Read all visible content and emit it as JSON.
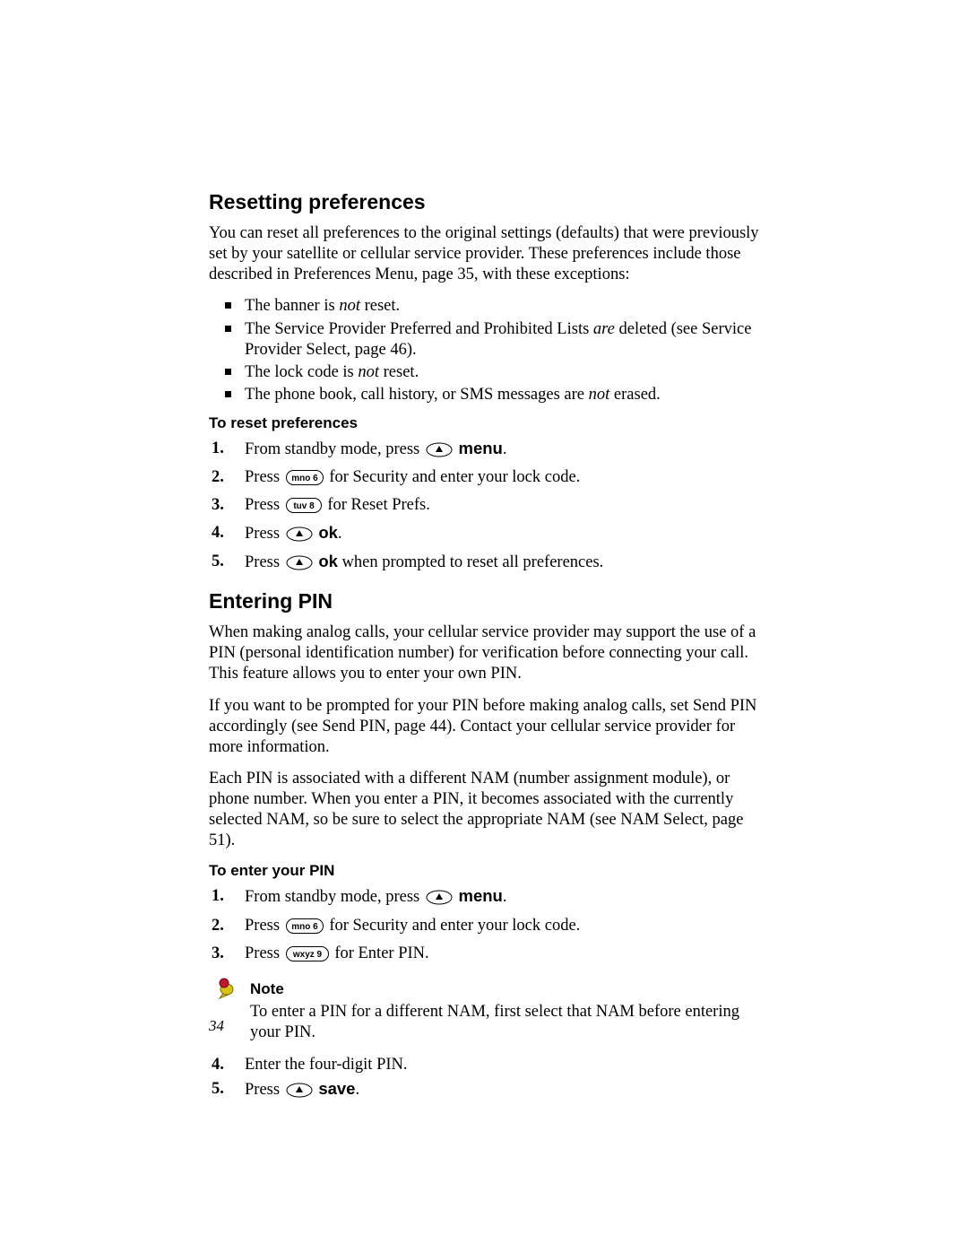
{
  "section1": {
    "heading": "Resetting preferences",
    "intro": "You can reset all preferences to the original settings (defaults) that were previously set by your satellite or cellular service provider. These preferences include those described in Preferences Menu, page 35, with these exceptions:",
    "bullets": {
      "b1a": "The banner is ",
      "b1b": "not",
      "b1c": " reset.",
      "b2a": "The Service Provider Preferred and Prohibited Lists ",
      "b2b": "are",
      "b2c": " deleted (see Service Provider Select, page 46).",
      "b3a": "The lock code is ",
      "b3b": "not",
      "b3c": " reset.",
      "b4a": "The phone book, call history, or SMS messages are ",
      "b4b": "not",
      "b4c": " erased."
    },
    "subhead": "To reset preferences",
    "step1a": "From standby mode, press ",
    "step1b": "menu",
    "step1c": ".",
    "step2a": "Press ",
    "step2b": " for Security and enter your lock code.",
    "step3a": "Press ",
    "step3b": " for Reset Prefs.",
    "step4a": "Press ",
    "step4b": "ok",
    "step4c": ".",
    "step5a": "Press ",
    "step5b": "ok",
    "step5c": " when prompted to reset all preferences."
  },
  "section2": {
    "heading": "Entering PIN",
    "para1": "When making analog calls, your cellular service provider may support the use of a PIN (personal identification number) for verification before connecting your call. This feature allows you to enter your own PIN.",
    "para2": "If you want to be prompted for your PIN before making analog calls, set Send PIN accordingly (see Send PIN, page 44). Contact your cellular service provider for more information.",
    "para3": "Each PIN is associated with a different NAM (number assignment module), or phone number. When you enter a PIN, it becomes associated with the currently selected NAM, so be sure to select the appropriate NAM (see NAM Select, page 51).",
    "subhead": "To enter your PIN",
    "step1a": "From standby mode, press ",
    "step1b": "menu",
    "step1c": ".",
    "step2a": "Press ",
    "step2b": " for Security and enter your lock code.",
    "step3a": "Press ",
    "step3b": " for Enter PIN.",
    "notehead": "Note",
    "notebody": "To enter a PIN for a different NAM, first select that NAM before entering your PIN.",
    "step4": "Enter the four-digit PIN.",
    "step5a": "Press ",
    "step5b": "save",
    "step5c": "."
  },
  "keys": {
    "mno6": "mno 6",
    "tuv8": "tuv 8",
    "wxyz9": "wxyz 9"
  },
  "pageNumber": "34"
}
